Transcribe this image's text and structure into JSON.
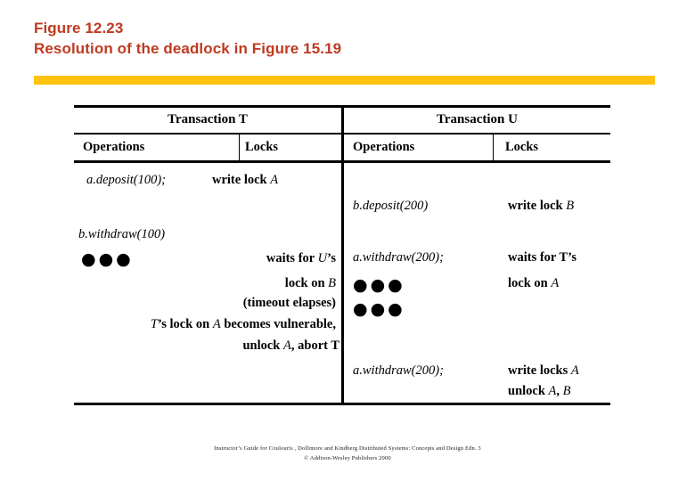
{
  "slide": {
    "title_line1": "Figure 12.23",
    "title_line2": "Resolution of the deadlock in Figure 15.19",
    "title_color": "#bf3a20",
    "accent_bar_color": "#ffc20e"
  },
  "table": {
    "group_headers": [
      {
        "label": "Transaction T"
      },
      {
        "label": "Transaction U"
      }
    ],
    "column_headers": [
      {
        "label": "Operations"
      },
      {
        "label": "Locks"
      },
      {
        "label": "Operations"
      },
      {
        "label": "Locks"
      }
    ],
    "transaction_t": {
      "operations": [
        {
          "text": "a.deposit(100);"
        },
        {
          "text": "b.withdraw(100)"
        },
        {
          "text": "●●●"
        }
      ],
      "locks": [
        {
          "text": "write lock ",
          "var": "A"
        },
        {
          "text": "waits for ",
          "var": "U",
          "suffix": "’s"
        },
        {
          "text": "lock on ",
          "var": "B"
        },
        {
          "text": "(timeout elapses)"
        },
        {
          "var": "T",
          "text": "’s lock on  ",
          "var2": "A",
          "suffix": " becomes vulnerable,"
        },
        {
          "text": "unlock  ",
          "var": "A",
          "suffix": ", abort T"
        }
      ]
    },
    "transaction_u": {
      "operations": [
        {
          "text": "b.deposit(200)"
        },
        {
          "text": "a.withdraw(200);"
        },
        {
          "text": "●●●"
        },
        {
          "text": "●●●"
        },
        {
          "text": "a.withdraw(200);"
        }
      ],
      "locks": [
        {
          "text": "write lock ",
          "var": "B"
        },
        {
          "text": "waits for T’s"
        },
        {
          "text": "lock on ",
          "var": "A"
        },
        {
          "text": "write locks ",
          "var": "A"
        },
        {
          "text": "unlock ",
          "var": "A",
          "suffix": ",  ",
          "var2": "B"
        }
      ]
    }
  },
  "footer": {
    "line1": "Instructor’s Guide for  Coulouris , Dollimore  and Kindberg   Distributed Systems: Concepts and Design   Edn. 3",
    "line2": "©  Addison-Wesley Publishers 2000"
  }
}
